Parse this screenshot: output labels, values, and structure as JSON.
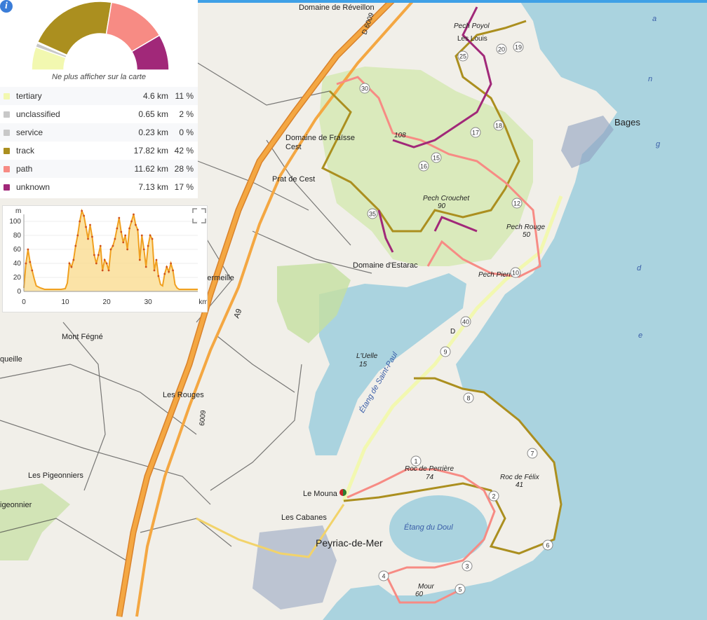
{
  "map": {
    "places": {
      "domaine_reveillon": "Domaine de Réveillon",
      "domaine_cest_1": "Domaine de Fraïsse",
      "domaine_cest_2": "Cest",
      "prat_de_cest": "Prat de Cest",
      "domaine_estarac": "Domaine d'Estarac",
      "vermeille": "-Vermeille",
      "bages": "Bages",
      "pech_crouchet": "Pech Crouchet",
      "pech_crouchet_alt": "90",
      "pech_rouge": "Pech Rouge",
      "pech_rouge_alt": "50",
      "pech_pierre": "Pech Pierre",
      "l_uelle": "L'Uelle",
      "l_uelle_alt": "15",
      "etang_st_paul": "Étang de Saint-Paul",
      "mont_fegne": "Mont Fégné",
      "les_rouges": "Les Rouges",
      "queille": "queille",
      "les_pigeonniers": "Les Pigeonniers",
      "pigeonnier": "igeonnier",
      "le_mouna": "Le Mouna",
      "les_cabanes": "Les Cabanes",
      "peyriac": "Peyriac-de-Mer",
      "etang_du_doul": "Étang du Doul",
      "roc_perriere": "Roc de Perrière",
      "roc_perriere_alt": "74",
      "roc_felix": "Roc de Félix",
      "roc_felix_alt": "41",
      "mour": "Mour",
      "mour_alt": "60",
      "pech_bages_1": "Pech Poyol",
      "les_louis": "Les Louis",
      "etang_letters": [
        "a",
        "n",
        "g",
        "d",
        "e"
      ],
      "alt_108": "108"
    },
    "roads": {
      "a9": "A9",
      "d6009_top": "D 6009",
      "d6009_bottom": "6009",
      "d_label": "D"
    },
    "markers": [
      "1",
      "2",
      "3",
      "4",
      "5",
      "6",
      "7",
      "8",
      "9",
      "10",
      "12",
      "15",
      "16",
      "17",
      "18",
      "19",
      "20",
      "25",
      "30",
      "35",
      "40"
    ]
  },
  "panel": {
    "info_icon": "i",
    "hide_link": "Ne plus afficher sur la carte",
    "legend": [
      {
        "name": "tertiary",
        "km": "4.6 km",
        "pct": "11 %",
        "color": "#f2f8b0",
        "value": 11
      },
      {
        "name": "unclassified",
        "km": "0.65 km",
        "pct": "2 %",
        "color": "#c8c8c8",
        "value": 2
      },
      {
        "name": "service",
        "km": "0.23 km",
        "pct": "0 %",
        "color": "#c8c8c8",
        "value": 0.5
      },
      {
        "name": "track",
        "km": "17.82 km",
        "pct": "42 %",
        "color": "#ab8f1f",
        "value": 42
      },
      {
        "name": "path",
        "km": "11.62 km",
        "pct": "28 %",
        "color": "#f78b84",
        "value": 28
      },
      {
        "name": "unknown",
        "km": "7.13 km",
        "pct": "17 %",
        "color": "#a12879",
        "value": 17
      }
    ]
  },
  "chart_data": {
    "type": "area",
    "ylabel": "m",
    "xlabel": "km",
    "xlim": [
      0,
      42
    ],
    "ylim": [
      0,
      110
    ],
    "xticks": [
      "0",
      "10",
      "20",
      "30",
      "km"
    ],
    "yticks": [
      "0",
      "20",
      "40",
      "60",
      "80",
      "100"
    ],
    "x": [
      0,
      0.5,
      1,
      1.5,
      2,
      2.5,
      3,
      4,
      5,
      6,
      7,
      8,
      9,
      10,
      10.5,
      11,
      11.5,
      12,
      12.5,
      13,
      13.5,
      14,
      14.5,
      15,
      15.5,
      16,
      16.5,
      17,
      17.5,
      18,
      18.5,
      19,
      19.5,
      20,
      20.5,
      21,
      21.5,
      22,
      22.5,
      23,
      23.5,
      24,
      24.5,
      25,
      25.5,
      26,
      26.5,
      27,
      27.5,
      28,
      28.5,
      29,
      29.5,
      30,
      30.5,
      31,
      31.5,
      32,
      32.5,
      33,
      33.5,
      34,
      34.5,
      35,
      35.5,
      36,
      36.5,
      37,
      37.5,
      38,
      39,
      40,
      41,
      42
    ],
    "y": [
      5,
      40,
      60,
      42,
      30,
      18,
      8,
      5,
      3,
      3,
      3,
      3,
      3,
      4,
      12,
      40,
      35,
      45,
      65,
      80,
      100,
      115,
      108,
      92,
      75,
      95,
      78,
      52,
      40,
      52,
      65,
      30,
      45,
      40,
      30,
      60,
      65,
      75,
      90,
      105,
      85,
      70,
      80,
      60,
      90,
      100,
      110,
      95,
      88,
      45,
      80,
      60,
      35,
      65,
      80,
      75,
      30,
      45,
      22,
      10,
      8,
      25,
      35,
      28,
      40,
      30,
      10,
      5,
      3,
      3,
      3,
      3,
      3,
      3
    ]
  }
}
